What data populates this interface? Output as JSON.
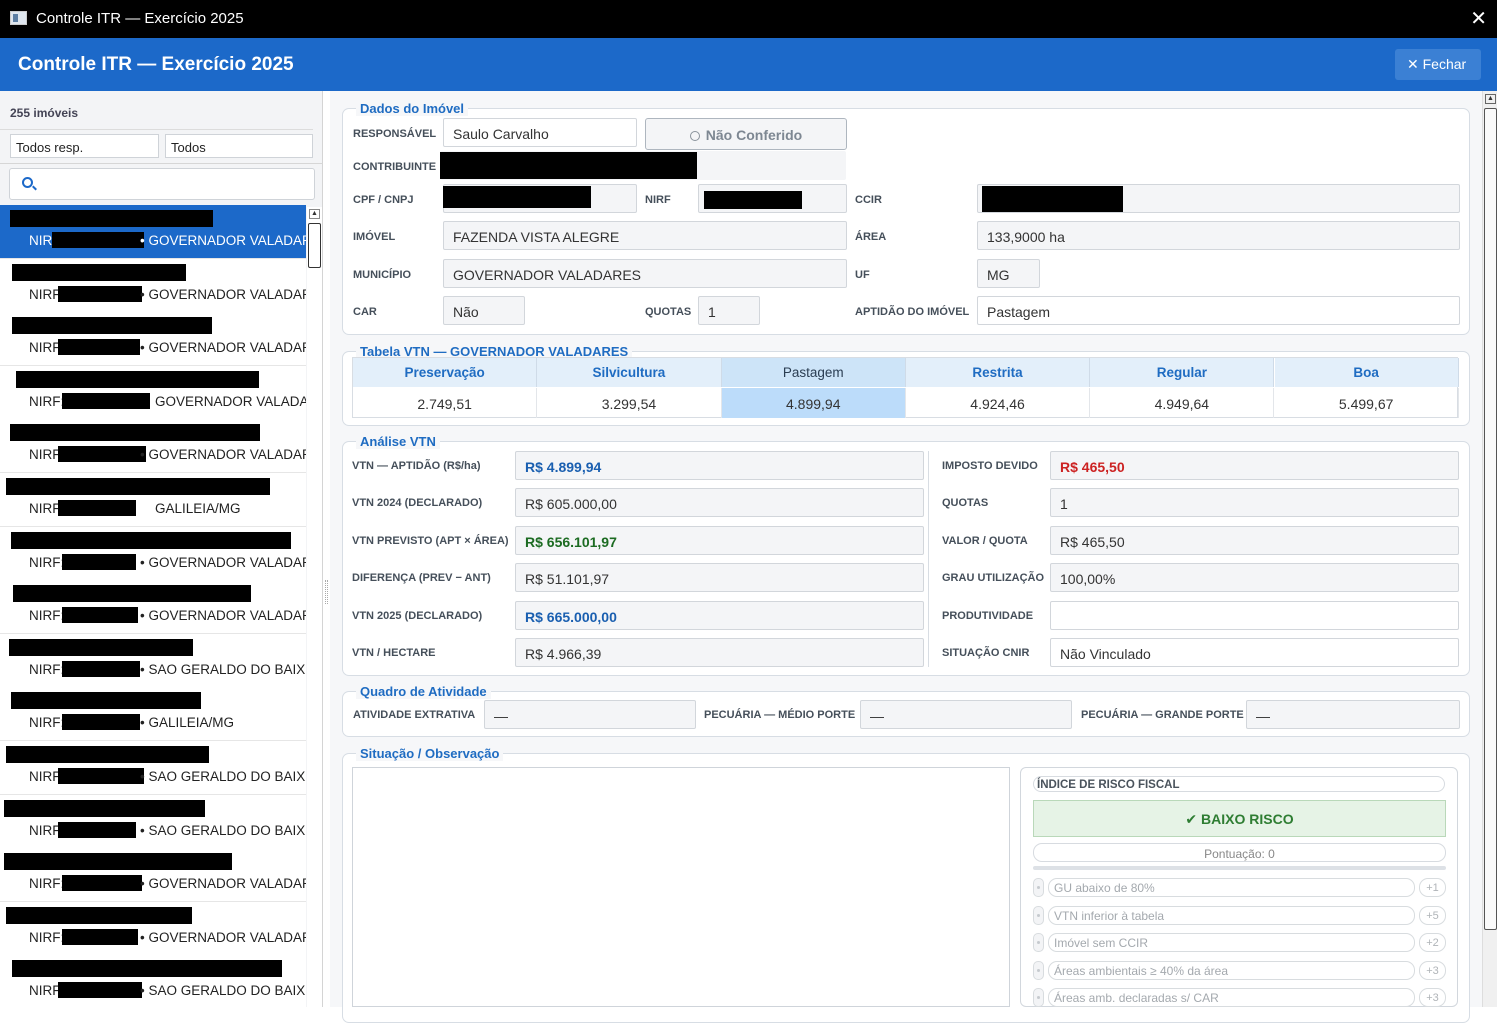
{
  "window": {
    "title": "Controle ITR — Exercício 2025",
    "close_glyph": "✕"
  },
  "header": {
    "title": "Controle ITR — Exercício 2025",
    "close_label": "✕  Fechar"
  },
  "sidebar": {
    "count": "255 imóveis",
    "filter_responsavel": "Todos resp.",
    "filter_status": "Todos",
    "search_placeholder": "",
    "items": [
      {
        "nirf_prefix": "NIRF",
        "municipio": "•  GOVERNADOR VALADARES/MG",
        "selected": true
      },
      {
        "nirf_prefix": "NIRF",
        "municipio": "•  GOVERNADOR VALADARES/MG"
      },
      {
        "nirf_prefix": "NIRF",
        "municipio": "•  GOVERNADOR VALADARES/MG"
      },
      {
        "nirf_prefix": "NIRF:",
        "municipio": "GOVERNADOR VALADARES/MG"
      },
      {
        "nirf_prefix": "NIRF",
        "municipio": "•  GOVERNADOR VALADARES/MG"
      },
      {
        "nirf_prefix": "NIRF",
        "municipio": "GALILEIA/MG"
      },
      {
        "nirf_prefix": "NIRF:",
        "municipio": "•  GOVERNADOR VALADARES/MG"
      },
      {
        "nirf_prefix": "NIRF:",
        "municipio": "•  GOVERNADOR VALADARES/MG"
      },
      {
        "nirf_prefix": "NIRF:",
        "municipio": "•  SAO GERALDO DO BAIXIO/MG"
      },
      {
        "nirf_prefix": "NIRF:",
        "municipio": "•  GALILEIA/MG"
      },
      {
        "nirf_prefix": "NIRF:",
        "municipio": "•  SAO GERALDO DO BAIXIO/MG"
      },
      {
        "nirf_prefix": "NIRF",
        "municipio": "•  SAO GERALDO DO BAIXIO/MG"
      },
      {
        "nirf_prefix": "NIRF:",
        "municipio": "•  GOVERNADOR VALADARES/MG"
      },
      {
        "nirf_prefix": "NIRF:",
        "municipio": "•  GOVERNADOR VALADARES/MG"
      },
      {
        "nirf_prefix": "NIRF",
        "municipio": "•  SAO GERALDO DO BAIXIO/MG"
      }
    ]
  },
  "dados": {
    "title": "Dados do Imóvel",
    "responsavel_label": "RESPONSÁVEL",
    "responsavel": "Saulo Carvalho",
    "status_button": "Não Conferido",
    "contribuinte_label": "CONTRIBUINTE",
    "cpf_label": "CPF / CNPJ",
    "nirf_label": "NIRF",
    "ccir_label": "CCIR",
    "imovel_label": "IMÓVEL",
    "imovel": "FAZENDA VISTA ALEGRE",
    "area_label": "ÁREA",
    "area": "133,9000 ha",
    "municipio_label": "MUNICÍPIO",
    "municipio": "GOVERNADOR VALADARES",
    "uf_label": "UF",
    "uf": "MG",
    "car_label": "CAR",
    "car": "Não",
    "quotas_label": "QUOTAS",
    "quotas": "1",
    "aptidao_label": "APTIDÃO DO IMÓVEL",
    "aptidao": "Pastagem"
  },
  "vtn_table": {
    "title": "Tabela VTN — GOVERNADOR VALADARES",
    "headers": [
      "Preservação",
      "Silvicultura",
      "Pastagem",
      "Restrita",
      "Regular",
      "Boa"
    ],
    "values": [
      "2.749,51",
      "3.299,54",
      "4.899,94",
      "4.924,46",
      "4.949,64",
      "5.499,67"
    ],
    "highlight_index": 2
  },
  "analise": {
    "title": "Análise VTN",
    "left": [
      {
        "label": "VTN — APTIDÃO (R$/ha)",
        "value": "R$ 4.899,94",
        "style": "blue"
      },
      {
        "label": "VTN 2024 (DECLARADO)",
        "value": "R$ 605.000,00",
        "style": ""
      },
      {
        "label": "VTN PREVISTO (APT × ÁREA)",
        "value": "R$ 656.101,97",
        "style": "green"
      },
      {
        "label": "DIFERENÇA (PREV − ANT)",
        "value": "R$ 51.101,97",
        "style": ""
      },
      {
        "label": "VTN 2025 (DECLARADO)",
        "value": "R$ 665.000,00",
        "style": "blue"
      },
      {
        "label": "VTN / HECTARE",
        "value": "R$ 4.966,39",
        "style": ""
      }
    ],
    "right": [
      {
        "label": "IMPOSTO DEVIDO",
        "value": "R$ 465,50",
        "style": "red"
      },
      {
        "label": "QUOTAS",
        "value": "1",
        "style": ""
      },
      {
        "label": "VALOR / QUOTA",
        "value": "R$ 465,50",
        "style": ""
      },
      {
        "label": "GRAU UTILIZAÇÃO",
        "value": "100,00%",
        "style": ""
      },
      {
        "label": "PRODUTIVIDADE",
        "value": "",
        "style": "w"
      },
      {
        "label": "SITUAÇÃO CNIR",
        "value": "Não Vinculado",
        "style": "w"
      }
    ]
  },
  "atividade": {
    "title": "Quadro de Atividade",
    "extrativa_label": "ATIVIDADE EXTRATIVA",
    "extrativa": "—",
    "medio_label": "PECUÁRIA — MÉDIO PORTE",
    "medio": "—",
    "grande_label": "PECUÁRIA — GRANDE PORTE",
    "grande": "—"
  },
  "situacao": {
    "title": "Situação / Observação",
    "observacao": "",
    "risk_title": "ÍNDICE DE RISCO FISCAL",
    "risk_badge": "✔  BAIXO RISCO",
    "score": "Pontuação: 0",
    "score_fraction": 0,
    "criteria": [
      {
        "text": "GU abaixo de 80%",
        "points": "+1"
      },
      {
        "text": "VTN inferior à tabela",
        "points": "+5"
      },
      {
        "text": "Imóvel sem CCIR",
        "points": "+2"
      },
      {
        "text": "Áreas ambientais ≥ 40% da área",
        "points": "+3"
      },
      {
        "text": "Áreas amb. declaradas s/ CAR",
        "points": "+3"
      }
    ]
  },
  "colors": {
    "accent": "#1c69c9",
    "low_risk": "#2e7d32",
    "tax": "#cc2222"
  }
}
